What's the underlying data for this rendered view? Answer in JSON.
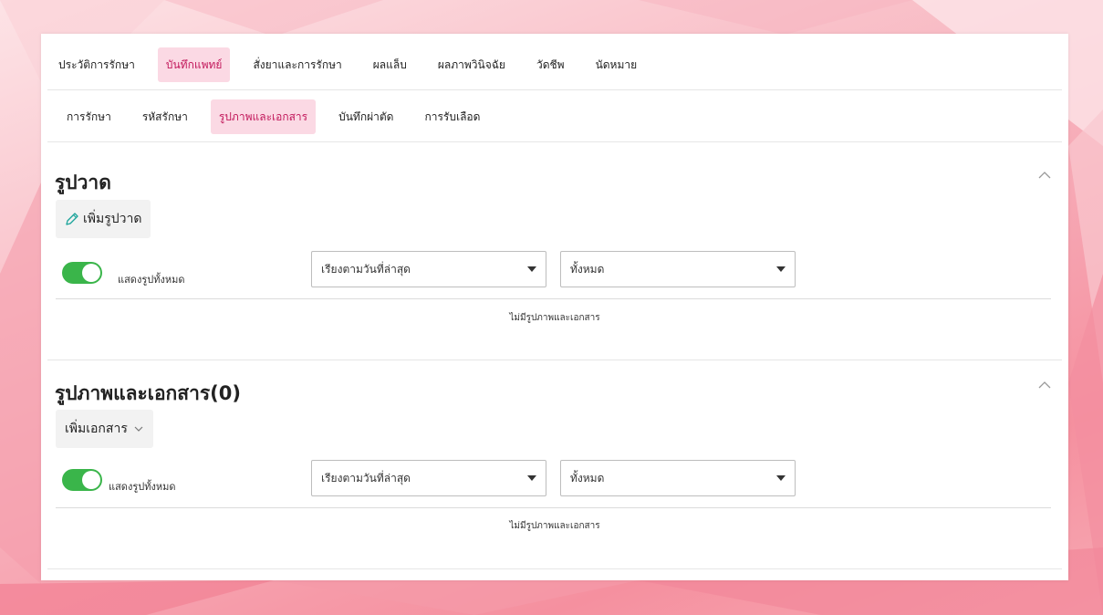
{
  "main_tabs": [
    {
      "label": "ประวัติการรักษา",
      "active": false
    },
    {
      "label": "บันทึกแพทย์",
      "active": true
    },
    {
      "label": "สั่งยาและการรักษา",
      "active": false
    },
    {
      "label": "ผลแล็บ",
      "active": false
    },
    {
      "label": "ผลภาพวินิจฉัย",
      "active": false
    },
    {
      "label": "วัดชีพ",
      "active": false
    },
    {
      "label": "นัดหมาย",
      "active": false
    }
  ],
  "sub_tabs": [
    {
      "label": "การรักษา",
      "active": false
    },
    {
      "label": "รหัสรักษา",
      "active": false
    },
    {
      "label": "รูปภาพและเอกสาร",
      "active": true
    },
    {
      "label": "บันทึกผ่าตัด",
      "active": false
    },
    {
      "label": "การรับเลือด",
      "active": false
    }
  ],
  "drawings": {
    "title": "รูปวาด",
    "add_label": "เพิ่มรูปวาด",
    "toggle_label": "แสดงรูปทั้งหมด",
    "toggle_on": true,
    "sort_value": "เรียงตามวันที่ล่าสุด",
    "filter_value": "ทั้งหมด",
    "empty_text": "ไม่มีรูปภาพและเอกสาร"
  },
  "documents": {
    "title": "รูปภาพและเอกสาร(0)",
    "add_label": "เพิ่มเอกสาร",
    "toggle_label": "แสดงรูปทั้งหมด",
    "toggle_on": true,
    "sort_value": "เรียงตามวันที่ล่าสุด",
    "filter_value": "ทั้งหมด",
    "empty_text": "ไม่มีรูปภาพและเอกสาร"
  },
  "colors": {
    "accent": "#c2185b",
    "active_tab_bg": "#fbd9e4",
    "toggle_on": "#3ab54a"
  },
  "icons": {
    "add_drawing": "pencil-icon",
    "add_document_menu": "chevron-down-icon",
    "collapse": "chevron-up-icon"
  }
}
